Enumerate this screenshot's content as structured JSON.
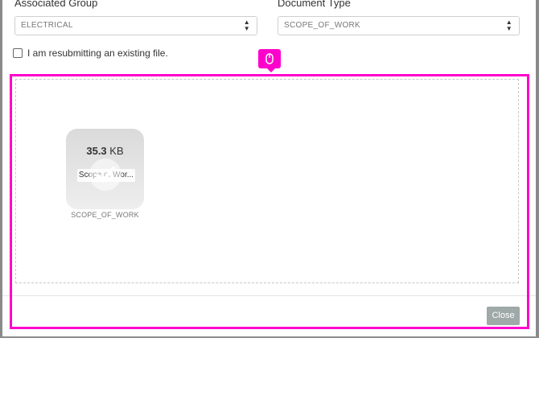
{
  "form": {
    "associated_group": {
      "label": "Associated Group",
      "value": "ELECTRICAL"
    },
    "document_type": {
      "label": "Document Type",
      "value": "SCOPE_OF_WORK"
    },
    "resubmit_checkbox": {
      "label": "I am resubmitting an existing file.",
      "checked": false
    }
  },
  "dropzone": {
    "file": {
      "size_value": "35.3",
      "size_unit": "KB",
      "name": "Scope of Wor...",
      "caption": "SCOPE_OF_WORK",
      "status_icon": "checkmark-icon"
    }
  },
  "footer": {
    "close_label": "Close"
  },
  "overlay": {
    "highlight_color": "#ff00cc",
    "cursor_icon": "mouse-icon"
  }
}
